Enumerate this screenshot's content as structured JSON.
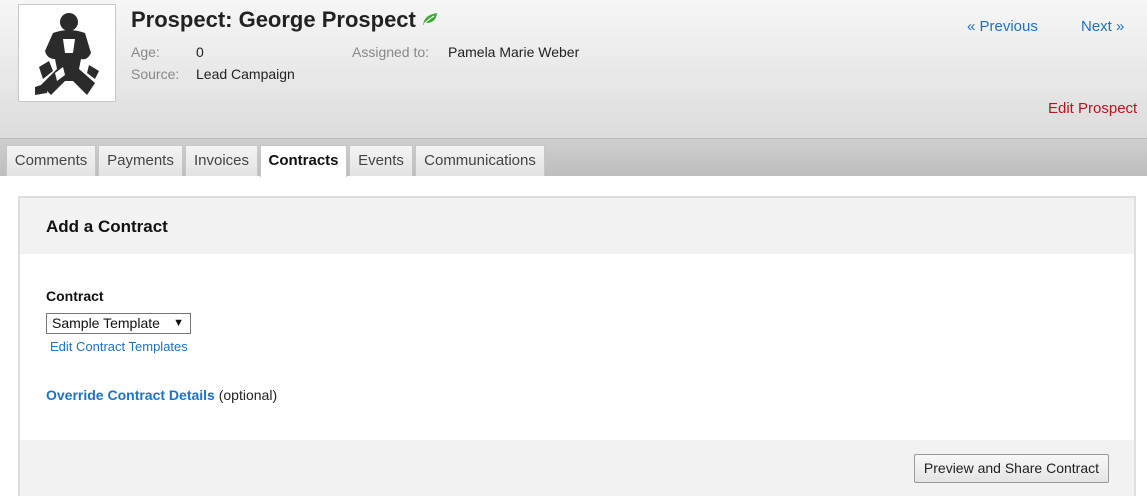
{
  "header": {
    "title": "Prospect: George Prospect",
    "age_label": "Age:",
    "age_value": "0",
    "source_label": "Source:",
    "source_value": "Lead Campaign",
    "assigned_label": "Assigned to:",
    "assigned_value": "Pamela Marie Weber",
    "prev_link": "« Previous",
    "next_link": "Next »",
    "edit_link": "Edit Prospect",
    "status_icon": "leaf-icon",
    "status_color": "#3aaa35"
  },
  "tabs": [
    {
      "label": "Comments"
    },
    {
      "label": "Payments"
    },
    {
      "label": "Invoices"
    },
    {
      "label": "Contracts",
      "active": true
    },
    {
      "label": "Events"
    },
    {
      "label": "Communications"
    }
  ],
  "panel": {
    "title": "Add a Contract",
    "contract_label": "Contract",
    "contract_selected": "Sample Template",
    "edit_templates_link": "Edit Contract Templates",
    "override_link": "Override Contract Details",
    "override_optional": "(optional)",
    "preview_button": "Preview and Share Contract"
  },
  "colors": {
    "link": "#1a73c9",
    "edit_link": "#c0101a"
  }
}
